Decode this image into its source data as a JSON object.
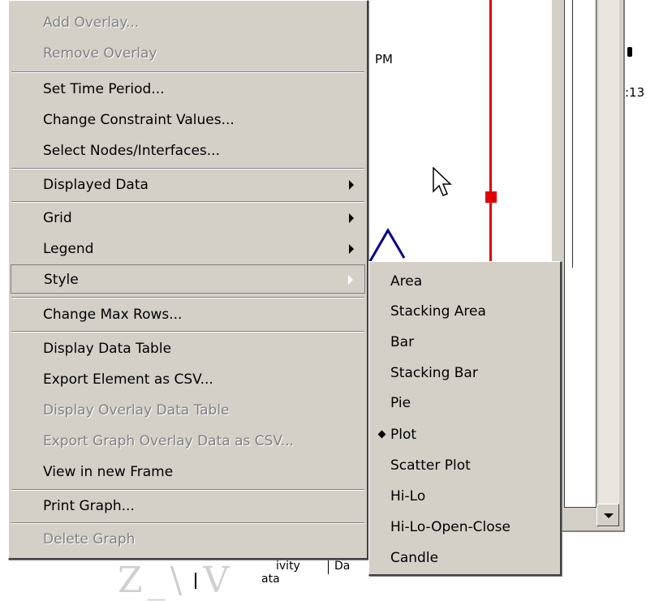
{
  "background": {
    "time_fragment": "PM",
    "time_fragment_2": ":13",
    "bottom_tab_a": "ivity",
    "bottom_tab_b": "Da",
    "bottom_tab_c": "ata"
  },
  "context_menu": {
    "items": [
      {
        "label": "Add Overlay...",
        "enabled": false
      },
      {
        "label": "Remove Overlay",
        "enabled": false
      },
      {
        "label": "Set Time Period...",
        "enabled": true
      },
      {
        "label": "Change Constraint Values...",
        "enabled": true
      },
      {
        "label": "Select Nodes/Interfaces...",
        "enabled": true
      },
      {
        "label": "Displayed Data",
        "enabled": true,
        "submenu": true
      },
      {
        "label": "Grid",
        "enabled": true,
        "submenu": true
      },
      {
        "label": "Legend",
        "enabled": true,
        "submenu": true
      },
      {
        "label": "Style",
        "enabled": true,
        "submenu": true,
        "highlighted": true
      },
      {
        "label": "Change Max Rows...",
        "enabled": true
      },
      {
        "label": "Display Data Table",
        "enabled": true
      },
      {
        "label": "Export Element as CSV...",
        "enabled": true
      },
      {
        "label": "Display Overlay Data Table",
        "enabled": false
      },
      {
        "label": "Export Graph Overlay Data as CSV...",
        "enabled": false
      },
      {
        "label": "View in new Frame",
        "enabled": true
      },
      {
        "label": "Print Graph...",
        "enabled": true
      },
      {
        "label": "Delete Graph",
        "enabled": false
      }
    ]
  },
  "style_submenu": {
    "items": [
      {
        "label": "Area",
        "selected": false
      },
      {
        "label": "Stacking Area",
        "selected": false
      },
      {
        "label": "Bar",
        "selected": false
      },
      {
        "label": "Stacking Bar",
        "selected": false
      },
      {
        "label": "Pie",
        "selected": false
      },
      {
        "label": "Plot",
        "selected": true
      },
      {
        "label": "Scatter Plot",
        "selected": false
      },
      {
        "label": "Hi-Lo",
        "selected": false
      },
      {
        "label": "Hi-Lo-Open-Close",
        "selected": false
      },
      {
        "label": "Candle",
        "selected": false
      }
    ]
  },
  "colors": {
    "menu_face": "#d4d0c8",
    "disabled_text": "#808080",
    "marker_red": "#e00000",
    "plot_line": "#00008b"
  }
}
